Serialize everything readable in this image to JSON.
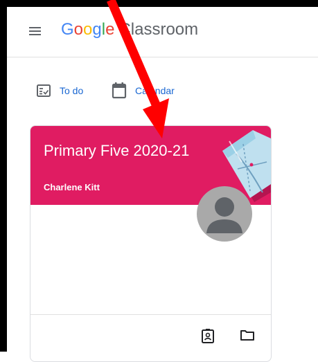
{
  "header": {
    "brand": {
      "g1": "G",
      "o1": "o",
      "o2": "o",
      "g2": "g",
      "l": "l",
      "e": "e"
    },
    "product": "Classroom",
    "menu_icon": "hamburger-menu-icon"
  },
  "quick_links": {
    "todo_label": "To do",
    "todo_icon": "assignment-checklist-icon",
    "calendar_label": "Calendar",
    "calendar_icon": "calendar-icon"
  },
  "class_card": {
    "title": "Primary Five 2020-21",
    "teacher": "Charlene Kitt",
    "banner_color": "#e01c62",
    "avatar_icon": "default-avatar-icon",
    "footer_icons": [
      "assignments-portrait-icon",
      "folder-icon"
    ]
  },
  "annotation": {
    "arrow_color": "#ff0000",
    "arrow_icon": "red-arrow-icon"
  },
  "colors": {
    "accent_link": "#1967d2",
    "google_blue": "#4285f4",
    "google_red": "#ea4335",
    "google_yellow": "#fbbc05",
    "google_green": "#34a853"
  }
}
